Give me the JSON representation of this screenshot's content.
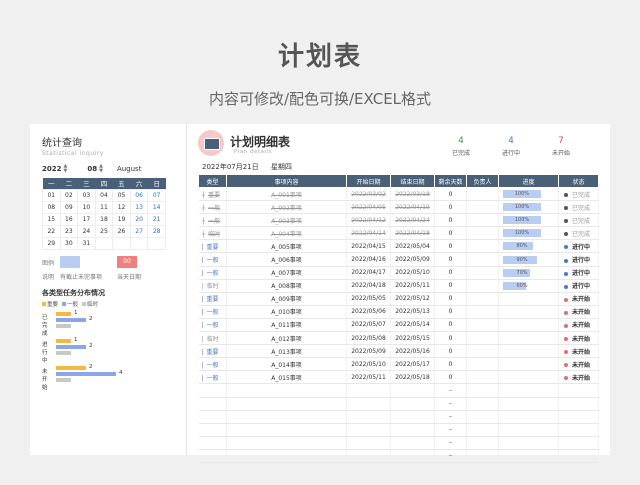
{
  "title": "计划表",
  "subtitle": "内容可修改/配色可换/EXCEL格式",
  "stats": {
    "title": "统计查询",
    "subtitle": "Statistical inquiry",
    "year": "2022",
    "month": "08",
    "month_name": "August"
  },
  "calendar": {
    "headers": [
      "一",
      "二",
      "三",
      "四",
      "五",
      "六",
      "日"
    ],
    "rows": [
      [
        "01",
        "02",
        "03",
        "04",
        "05",
        "06",
        "07"
      ],
      [
        "08",
        "09",
        "10",
        "11",
        "12",
        "13",
        "14"
      ],
      [
        "15",
        "16",
        "17",
        "18",
        "19",
        "20",
        "21"
      ],
      [
        "22",
        "23",
        "24",
        "25",
        "26",
        "27",
        "28"
      ],
      [
        "29",
        "30",
        "31",
        "",
        "",
        "",
        ""
      ]
    ]
  },
  "legend": {
    "label_a": "图例",
    "box2": "00",
    "label_b": "说明",
    "desc1": "有截止未完事项",
    "desc2": "当天日期"
  },
  "distribution": {
    "title": "各类型任务分布情况",
    "series": [
      {
        "name": "重要",
        "color": "#f5b942"
      },
      {
        "name": "一般",
        "color": "#8aa5e8"
      },
      {
        "name": "临时",
        "color": "#c8c8c8"
      }
    ],
    "groups": [
      {
        "label": "已完成",
        "values": [
          1,
          2,
          1
        ]
      },
      {
        "label": "进行中",
        "values": [
          1,
          2,
          1
        ]
      },
      {
        "label": "未开始",
        "values": [
          2,
          4,
          1
        ]
      }
    ],
    "shown_labels": [
      "1",
      "2",
      "1",
      "2",
      "2",
      "4"
    ]
  },
  "plan": {
    "title": "计划明细表",
    "subtitle": "Plan details",
    "date": "2022年07月21日",
    "weekday": "星期四",
    "counts": [
      {
        "value": "4",
        "label": "已完成",
        "color": "#3a9a5c"
      },
      {
        "value": "4",
        "label": "进行中",
        "color": "#4a78c8"
      },
      {
        "value": "7",
        "label": "未开始",
        "color": "#d9534f"
      }
    ],
    "headers": [
      "类型",
      "事项内容",
      "开始日期",
      "结束日期",
      "剩余天数",
      "负责人",
      "进度",
      "状态"
    ],
    "rows": [
      {
        "type": "重要",
        "content": "A_001事项",
        "start": "2022/03/02",
        "end": "2022/03/18",
        "days": "0",
        "owner": "",
        "progress": "100%",
        "pct": 100,
        "status": "已完成",
        "state": "done"
      },
      {
        "type": "一般",
        "content": "A_002事项",
        "start": "2022/04/05",
        "end": "2022/04/19",
        "days": "0",
        "owner": "",
        "progress": "100%",
        "pct": 100,
        "status": "已完成",
        "state": "done"
      },
      {
        "type": "一般",
        "content": "A_003事项",
        "start": "2022/04/12",
        "end": "2022/04/24",
        "days": "0",
        "owner": "",
        "progress": "100%",
        "pct": 100,
        "status": "已完成",
        "state": "done"
      },
      {
        "type": "临时",
        "content": "A_004事项",
        "start": "2022/04/14",
        "end": "2022/04/18",
        "days": "0",
        "owner": "",
        "progress": "100%",
        "pct": 100,
        "status": "已完成",
        "state": "done"
      },
      {
        "type": "重要",
        "content": "A_005事项",
        "start": "2022/04/15",
        "end": "2022/05/04",
        "days": "0",
        "owner": "",
        "progress": "80%",
        "pct": 80,
        "status": "进行中",
        "state": "prog"
      },
      {
        "type": "一般",
        "content": "A_006事项",
        "start": "2022/04/16",
        "end": "2022/05/09",
        "days": "0",
        "owner": "",
        "progress": "90%",
        "pct": 90,
        "status": "进行中",
        "state": "prog"
      },
      {
        "type": "一般",
        "content": "A_007事项",
        "start": "2022/04/17",
        "end": "2022/05/10",
        "days": "0",
        "owner": "",
        "progress": "70%",
        "pct": 70,
        "status": "进行中",
        "state": "prog"
      },
      {
        "type": "临时",
        "content": "A_008事项",
        "start": "2022/04/18",
        "end": "2022/05/11",
        "days": "0",
        "owner": "",
        "progress": "60%",
        "pct": 60,
        "status": "进行中",
        "state": "prog"
      },
      {
        "type": "重要",
        "content": "A_009事项",
        "start": "2022/05/05",
        "end": "2022/05/12",
        "days": "0",
        "owner": "",
        "progress": "",
        "pct": 0,
        "status": "未开始",
        "state": "todo"
      },
      {
        "type": "一般",
        "content": "A_010事项",
        "start": "2022/05/06",
        "end": "2022/05/13",
        "days": "0",
        "owner": "",
        "progress": "",
        "pct": 0,
        "status": "未开始",
        "state": "todo"
      },
      {
        "type": "一般",
        "content": "A_011事项",
        "start": "2022/05/07",
        "end": "2022/05/14",
        "days": "0",
        "owner": "",
        "progress": "",
        "pct": 0,
        "status": "未开始",
        "state": "todo"
      },
      {
        "type": "临时",
        "content": "A_012事项",
        "start": "2022/05/08",
        "end": "2022/05/15",
        "days": "0",
        "owner": "",
        "progress": "",
        "pct": 0,
        "status": "未开始",
        "state": "todo"
      },
      {
        "type": "重要",
        "content": "A_013事项",
        "start": "2022/05/09",
        "end": "2022/05/16",
        "days": "0",
        "owner": "",
        "progress": "",
        "pct": 0,
        "status": "未开始",
        "state": "todo"
      },
      {
        "type": "一般",
        "content": "A_014事项",
        "start": "2022/05/10",
        "end": "2022/05/17",
        "days": "0",
        "owner": "",
        "progress": "",
        "pct": 0,
        "status": "未开始",
        "state": "todo"
      },
      {
        "type": "一般",
        "content": "A_015事项",
        "start": "2022/05/11",
        "end": "2022/05/18",
        "days": "0",
        "owner": "",
        "progress": "",
        "pct": 0,
        "status": "未开始",
        "state": "todo"
      }
    ],
    "empty_dash": "–",
    "empty_rows": 6
  }
}
